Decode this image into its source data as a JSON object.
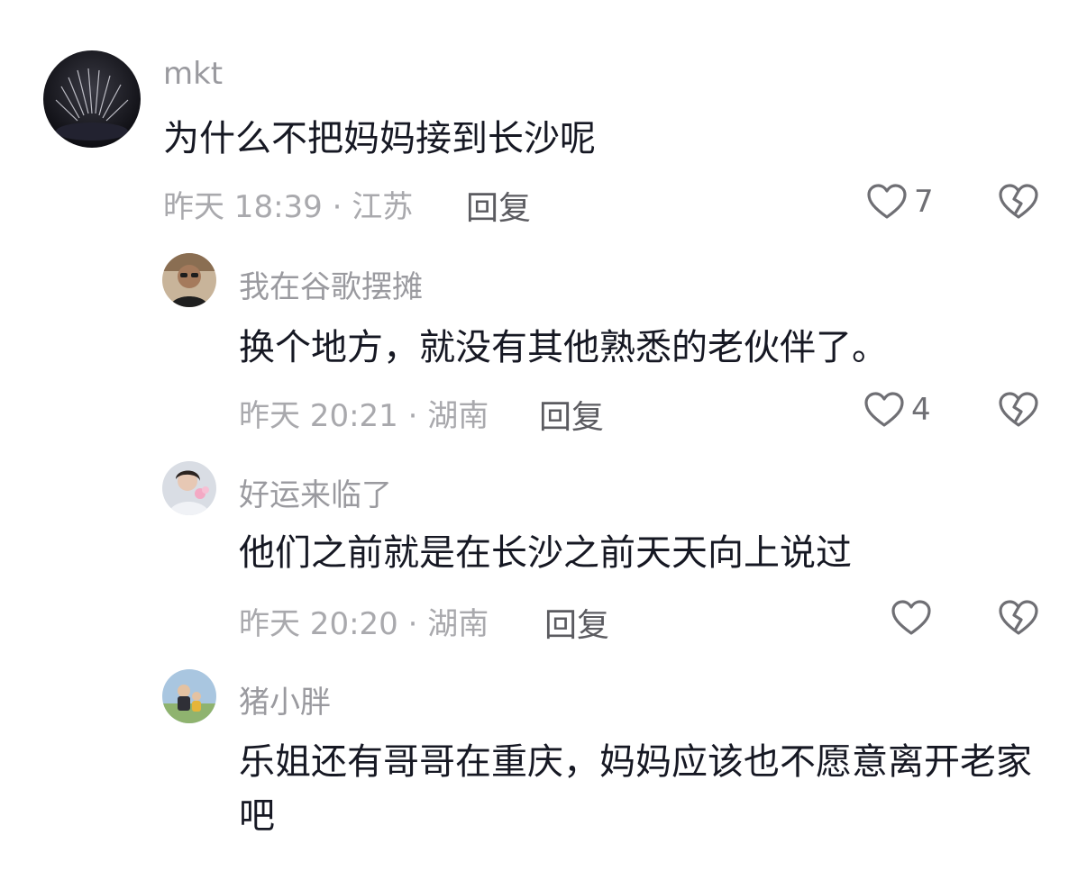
{
  "comments": [
    {
      "username": "mkt",
      "text": "为什么不把妈妈接到长沙呢",
      "meta": "昨天 18:39 · 江苏",
      "reply_label": "回复",
      "likes": "7"
    },
    {
      "username": "我在谷歌摆摊",
      "text": "换个地方，就没有其他熟悉的老伙伴了。",
      "meta": "昨天 20:21 · 湖南",
      "reply_label": "回复",
      "likes": "4"
    },
    {
      "username": "好运来临了",
      "text": "他们之前就是在长沙之前天天向上说过",
      "meta": "昨天 20:20 · 湖南",
      "reply_label": "回复",
      "likes": ""
    },
    {
      "username": "猪小胖",
      "text": "乐姐还有哥哥在重庆，妈妈应该也不愿意离开老家吧"
    }
  ],
  "icons": {
    "like": "heart-outline-icon",
    "dislike": "broken-heart-icon"
  },
  "colors": {
    "text_primary": "#161823",
    "text_secondary": "#9a9a9f",
    "icon_gray": "#6f6f74"
  }
}
